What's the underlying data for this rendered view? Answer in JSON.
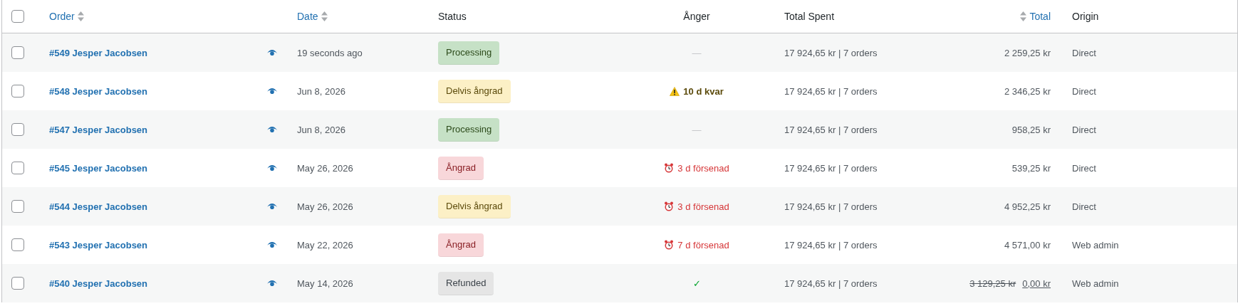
{
  "columns": [
    {
      "label": "Order",
      "sortable": true
    },
    {
      "label": "Date",
      "sortable": true
    },
    {
      "label": "Status",
      "sortable": false
    },
    {
      "label": "Ånger",
      "sortable": false
    },
    {
      "label": "Total Spent",
      "sortable": false
    },
    {
      "label": "Total",
      "sortable": true
    },
    {
      "label": "Origin",
      "sortable": false
    }
  ],
  "header_checkbox": {
    "checked": false
  },
  "rows": [
    {
      "checked": false,
      "order": "#549 Jesper Jacobsen",
      "date": "19 seconds ago",
      "status": {
        "label": "Processing",
        "kind": "processing"
      },
      "anger": {
        "kind": "none",
        "text": "—"
      },
      "total_spent": "17 924,65 kr | 7 orders",
      "total": "2 259,25 kr",
      "origin": "Direct"
    },
    {
      "checked": false,
      "order": "#548 Jesper Jacobsen",
      "date": "Jun 8, 2026",
      "status": {
        "label": "Delvis ångrad",
        "kind": "partial"
      },
      "anger": {
        "kind": "warning",
        "text": "10 d kvar"
      },
      "total_spent": "17 924,65 kr | 7 orders",
      "total": "2 346,25 kr",
      "origin": "Direct"
    },
    {
      "checked": false,
      "order": "#547 Jesper Jacobsen",
      "date": "Jun 8, 2026",
      "status": {
        "label": "Processing",
        "kind": "processing"
      },
      "anger": {
        "kind": "none",
        "text": "—"
      },
      "total_spent": "17 924,65 kr | 7 orders",
      "total": "958,25 kr",
      "origin": "Direct"
    },
    {
      "checked": false,
      "order": "#545 Jesper Jacobsen",
      "date": "May 26, 2026",
      "status": {
        "label": "Ångrad",
        "kind": "withdrawn"
      },
      "anger": {
        "kind": "overdue",
        "text": "3 d försenad"
      },
      "total_spent": "17 924,65 kr | 7 orders",
      "total": "539,25 kr",
      "origin": "Direct"
    },
    {
      "checked": false,
      "order": "#544 Jesper Jacobsen",
      "date": "May 26, 2026",
      "status": {
        "label": "Delvis ångrad",
        "kind": "partial"
      },
      "anger": {
        "kind": "overdue",
        "text": "3 d försenad"
      },
      "total_spent": "17 924,65 kr | 7 orders",
      "total": "4 952,25 kr",
      "origin": "Direct"
    },
    {
      "checked": false,
      "order": "#543 Jesper Jacobsen",
      "date": "May 22, 2026",
      "status": {
        "label": "Ångrad",
        "kind": "withdrawn"
      },
      "anger": {
        "kind": "overdue",
        "text": "7 d försenad"
      },
      "total_spent": "17 924,65 kr | 7 orders",
      "total": "4 571,00 kr",
      "origin": "Web admin"
    },
    {
      "checked": false,
      "order": "#540 Jesper Jacobsen",
      "date": "May 14, 2026",
      "status": {
        "label": "Refunded",
        "kind": "refunded"
      },
      "anger": {
        "kind": "done",
        "text": "✓"
      },
      "total_spent": "17 924,65 kr | 7 orders",
      "total_original": "3 129,25 kr",
      "total": "0,00 kr",
      "origin": "Web admin"
    }
  ]
}
